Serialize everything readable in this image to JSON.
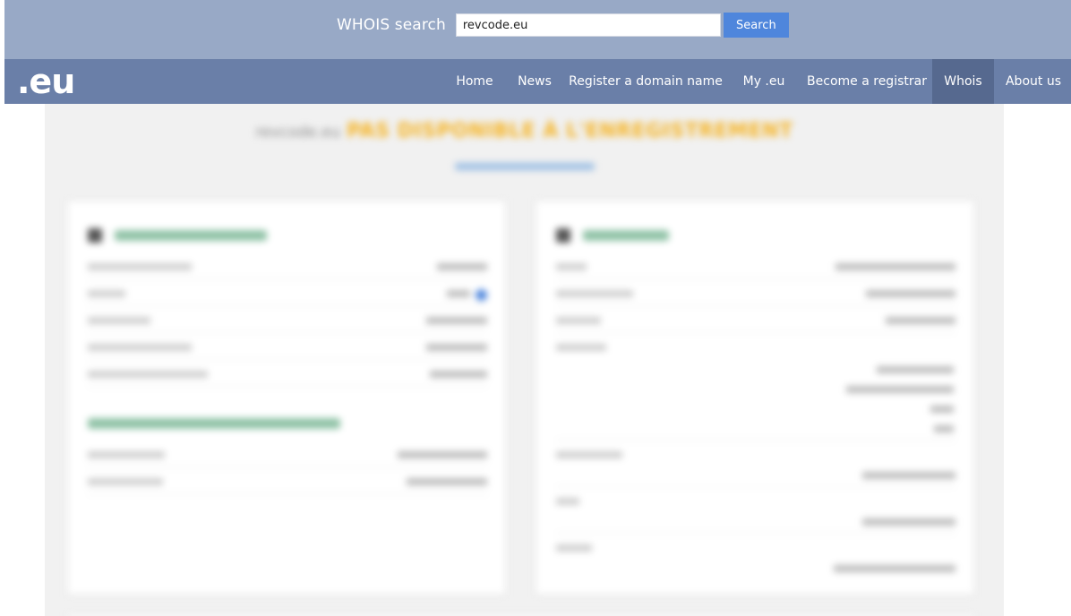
{
  "search": {
    "label": "WHOIS search",
    "value": "revcode.eu",
    "button": "Search"
  },
  "nav": {
    "logo": ".eu",
    "items": [
      {
        "label": "Home",
        "active": false
      },
      {
        "label": "News",
        "active": false
      },
      {
        "label": "Register a domain name",
        "active": false
      },
      {
        "label": "My .eu",
        "active": false
      },
      {
        "label": "Become a registrar",
        "active": false
      },
      {
        "label": "Whois",
        "active": true
      },
      {
        "label": "About us",
        "active": false
      }
    ]
  },
  "colors": {
    "topbar": "#98a9c6",
    "navbar": "#6a7fa8",
    "nav_active": "#56698f",
    "search_button": "#4f86dc",
    "status_accent": "#f5b323",
    "section_heading": "#2e8a5c"
  },
  "result": {
    "domain": "revcode.eu",
    "status_text": "PAS DISPONIBLE À L'ENREGISTREMENT"
  }
}
